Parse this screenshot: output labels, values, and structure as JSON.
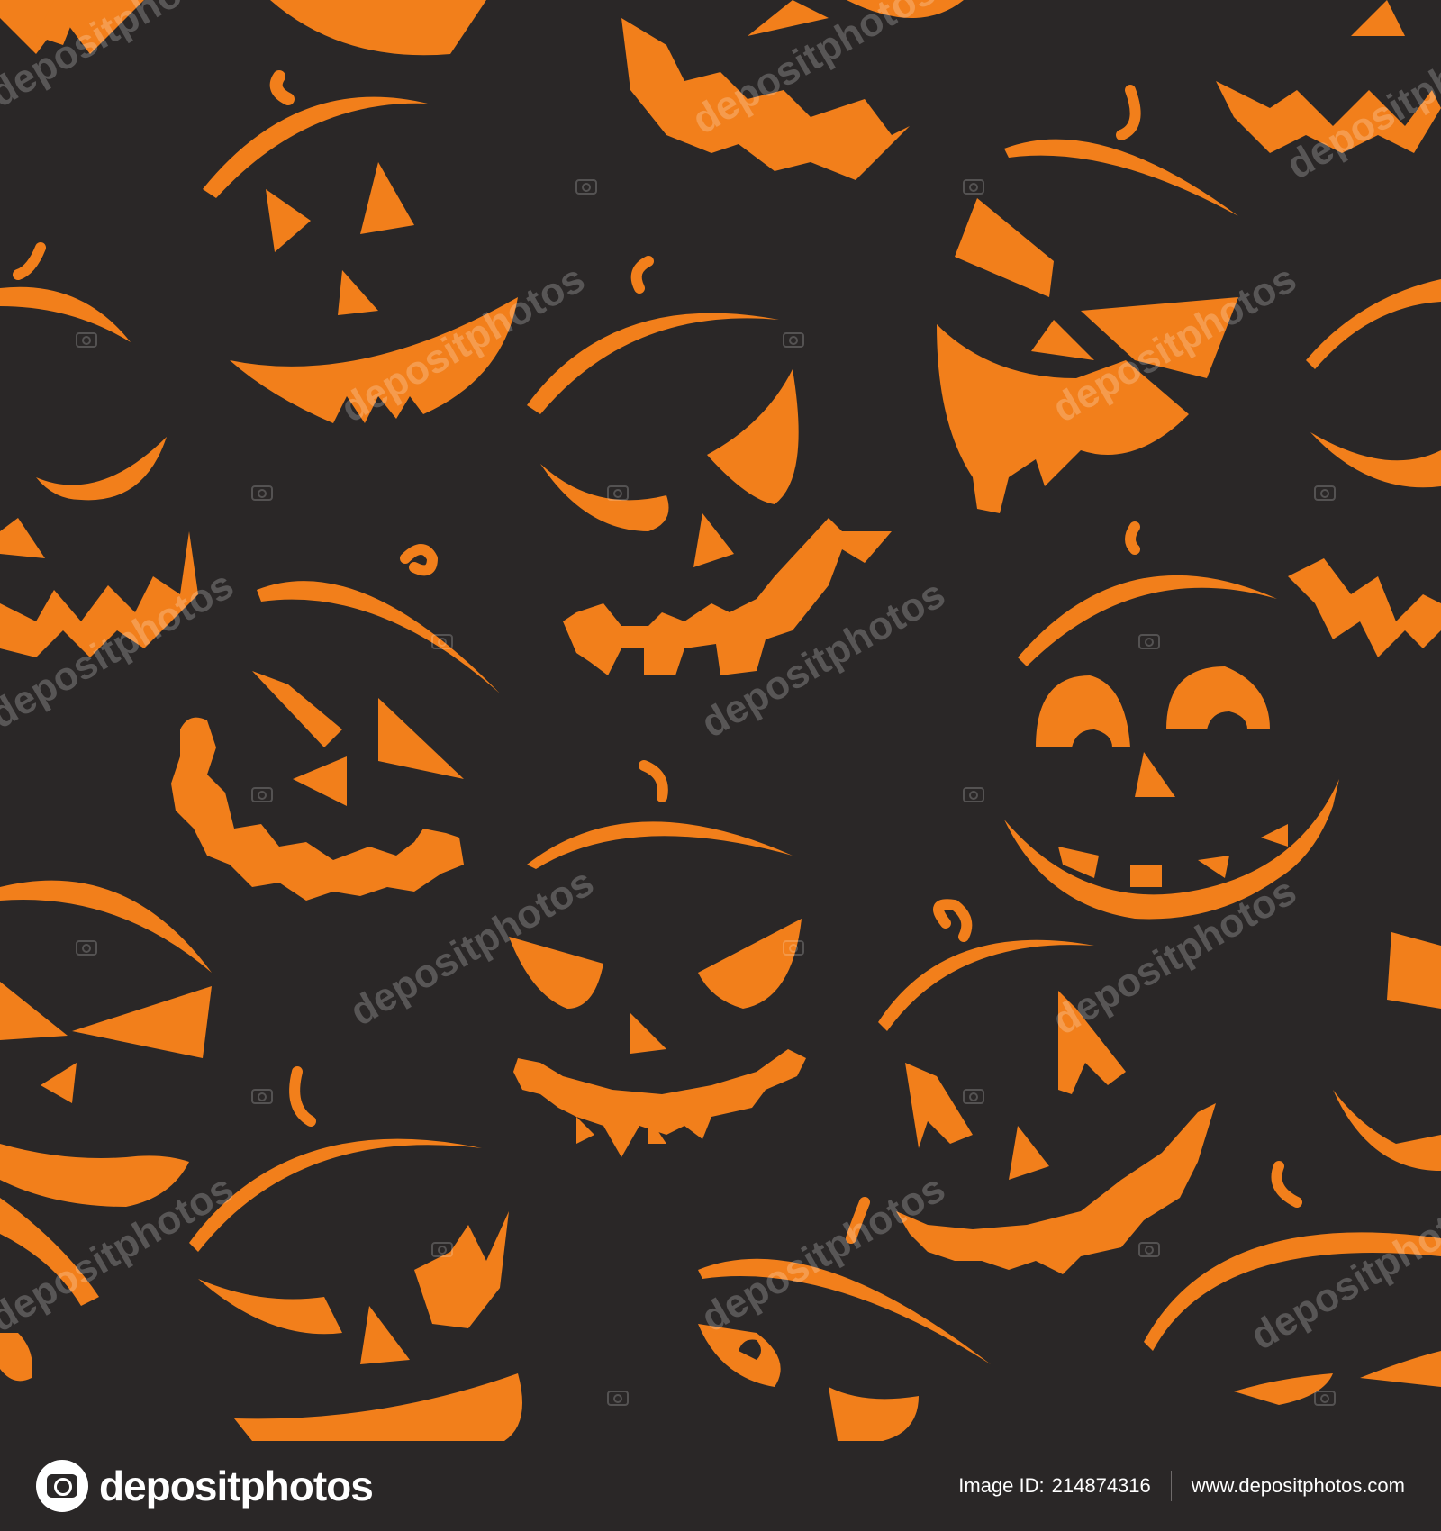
{
  "pattern": {
    "subject": "jack-o-lantern faces seamless pattern",
    "background_color": "#2a2727",
    "accent_color": "#f27f1b"
  },
  "watermark": {
    "text": "depositphotos"
  },
  "footer": {
    "logo_text": "depositphotos",
    "image_id_label": "Image ID:",
    "image_id": "214874316",
    "website": "www.depositphotos.com"
  }
}
